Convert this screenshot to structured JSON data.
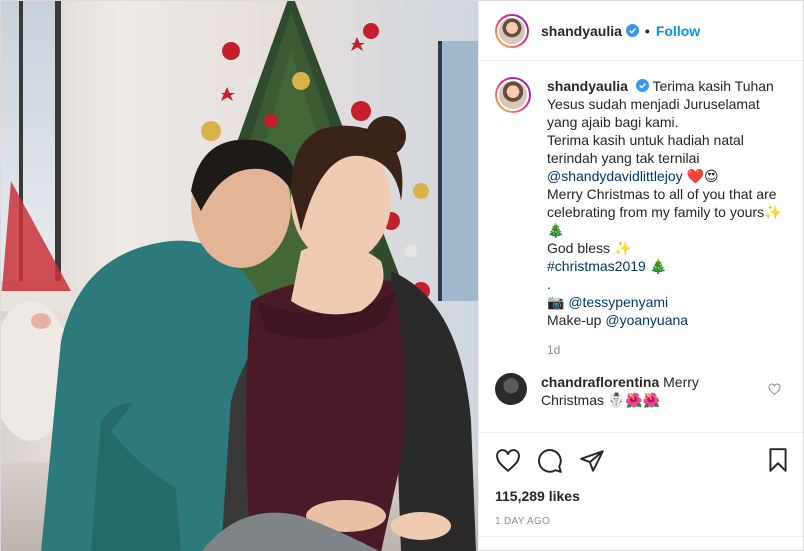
{
  "header": {
    "username": "shandyaulia",
    "separator": "•",
    "follow_label": "Follow"
  },
  "caption": {
    "username": "shandyaulia",
    "line1": "Terima kasih Tuhan Yesus sudah menjadi Juruselamat yang ajaib bagi kami.",
    "line2": "Terima kasih untuk hadiah natal terindah yang tak ternilai",
    "mention1": "@shandydavidlittlejoy",
    "emoji1": "❤️😍",
    "line3": "Merry Christmas to all of you that are celebrating from my family to yours",
    "emoji2": "✨🎄",
    "line4": "God bless",
    "emoji3": "✨",
    "hashtag": "#christmas2019",
    "emoji4": "🎄",
    "dot": ".",
    "camera": "📷",
    "mention2": "@tessypenyami",
    "makeup_label": "Make-up",
    "mention3": "@yoanyuana",
    "time": "1d"
  },
  "comment": {
    "username": "chandraflorentina",
    "text": "Merry Christmas",
    "emoji": "☃️🌺🌺"
  },
  "likes": "115,289 likes",
  "posted": "1 DAY AGO",
  "colors": {
    "link": "#0095f6",
    "mention": "#00376b",
    "muted": "#8e8e8e",
    "verified": "#3897f0"
  }
}
